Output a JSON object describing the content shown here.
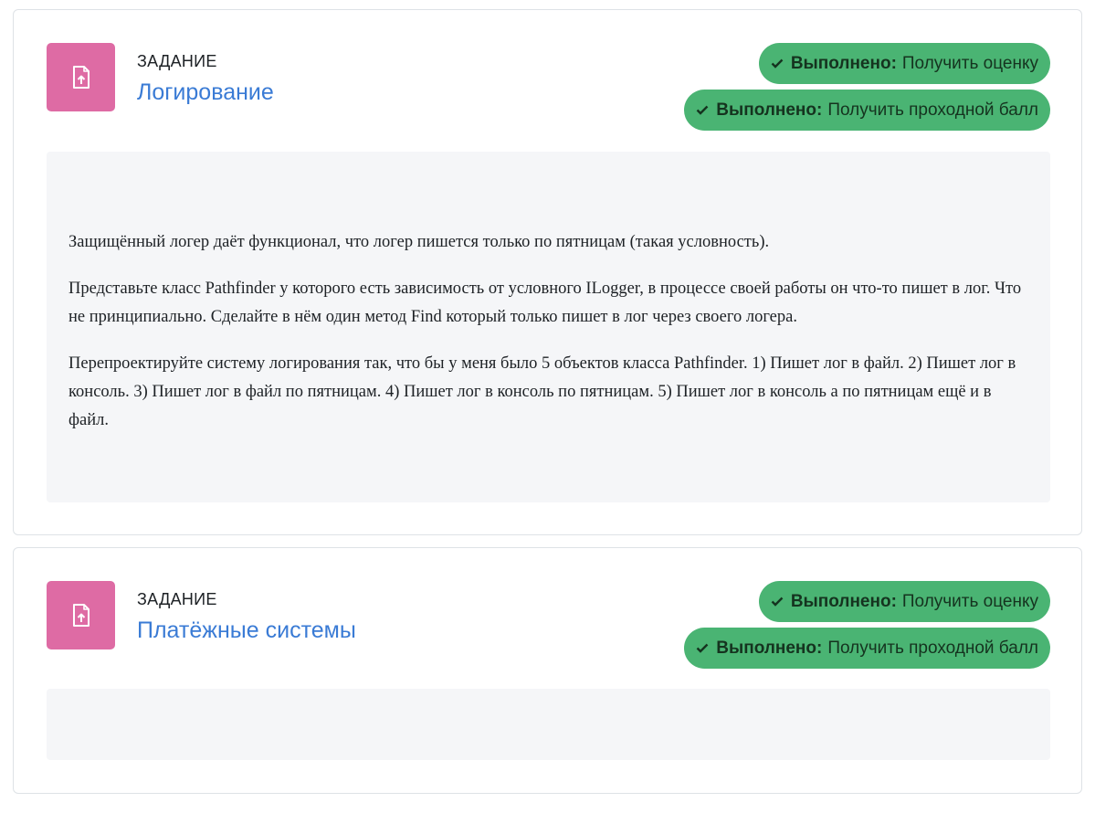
{
  "activities": [
    {
      "type_label": "ЗАДАНИЕ",
      "title": "Логирование",
      "icon": "assignment-upload-icon",
      "completion": [
        {
          "status": "Выполнено:",
          "text": "Получить оценку"
        },
        {
          "status": "Выполнено:",
          "text": "Получить проходной балл"
        }
      ],
      "description": [
        "Защищённый логер даёт функционал, что логер пишется только по пятницам (такая условность).",
        "Представьте класс Pathfinder у которого есть зависимость от условного ILogger, в процессе своей работы он что-то пишет в лог. Что не принципиально. Сделайте в нём один метод Find который только пишет в лог через своего логера.",
        "Перепроектируйте систему логирования так, что бы у меня было 5 объектов класса Pathfinder. 1) Пишет лог в файл. 2) Пишет лог в консоль. 3) Пишет лог в файл по пятницам. 4) Пишет лог в консоль по пятницам. 5) Пишет лог в консоль а по пятницам ещё и в файл."
      ]
    },
    {
      "type_label": "ЗАДАНИЕ",
      "title": "Платёжные системы",
      "icon": "assignment-upload-icon",
      "completion": [
        {
          "status": "Выполнено:",
          "text": "Получить оценку"
        },
        {
          "status": "Выполнено:",
          "text": "Получить проходной балл"
        }
      ],
      "description": []
    }
  ],
  "colors": {
    "icon_bg": "#de6ba4",
    "link": "#3a7bd5",
    "badge_bg": "#4ab473",
    "description_bg": "#f5f6f8"
  }
}
